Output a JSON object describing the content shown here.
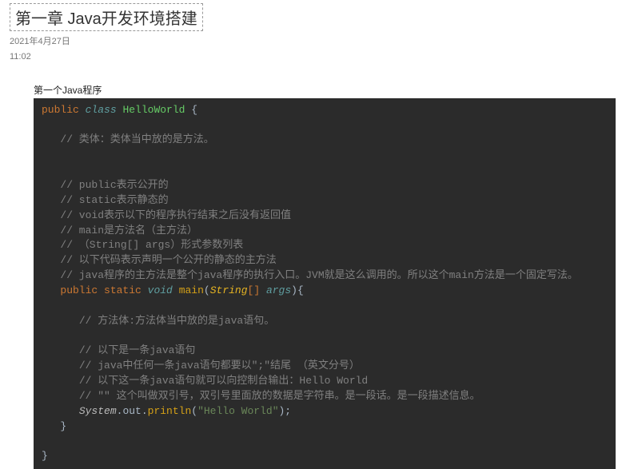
{
  "header": {
    "title": "第一章 Java开发环境搭建",
    "date": "2021年4月27日",
    "time": "11:02",
    "subtitle": "第一个Java程序"
  },
  "code": {
    "l1_public": "public",
    "l1_class": "class",
    "l1_name": "HelloWorld",
    "l1_brace": "{",
    "c1": "// 类体：类体当中放的是方法。",
    "c2": "// public表示公开的",
    "c3": "// static表示静态的",
    "c4": "// void表示以下的程序执行结束之后没有返回值",
    "c5": "// main是方法名（主方法）",
    "c6": "// （String[] args）形式参数列表",
    "c7": "// 以下代码表示声明一个公开的静态的主方法",
    "c8": "// java程序的主方法是整个java程序的执行入口。JVM就是这么调用的。所以这个main方法是一个固定写法。",
    "sig_public": "public",
    "sig_static": "static",
    "sig_void": "void",
    "sig_main": "main",
    "sig_type": "String",
    "sig_brk": "[]",
    "sig_args": "args",
    "sig_open": "(",
    "sig_close": ")",
    "sig_brace": "{",
    "c9": "// 方法体:方法体当中放的是java语句。",
    "c10": "// 以下是一条java语句",
    "c11": "// java中任何一条java语句都要以\";\"结尾 （英文分号）",
    "c12": "// 以下这一条java语句就可以向控制台输出：Hello World",
    "c13": "// \"\" 这个叫做双引号，双引号里面放的数据是字符串。是一段话。是一段描述信息。",
    "out_sys": "System",
    "out_dot1": ".",
    "out_out": "out",
    "out_dot2": ".",
    "out_println": "println",
    "out_open": "(",
    "out_str": "\"Hello World\"",
    "out_close": ");",
    "close1": "}",
    "close2": "}"
  }
}
